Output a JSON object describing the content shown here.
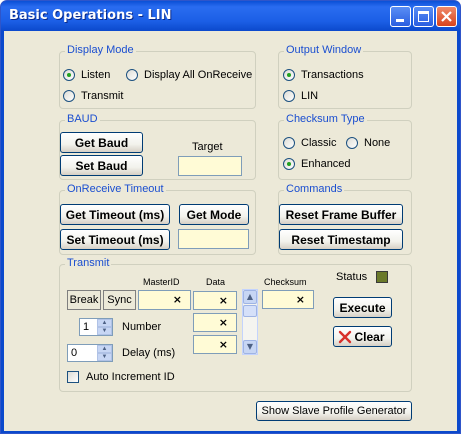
{
  "window": {
    "title": "Basic Operations - LIN"
  },
  "display_mode": {
    "legend": "Display Mode",
    "options": [
      {
        "label": "Listen",
        "selected": true
      },
      {
        "label": "Display All OnReceive",
        "selected": false
      },
      {
        "label": "Transmit",
        "selected": false
      }
    ]
  },
  "output_window": {
    "legend": "Output Window",
    "options": [
      {
        "label": "Transactions",
        "selected": true
      },
      {
        "label": "LIN",
        "selected": false
      }
    ]
  },
  "baud": {
    "legend": "BAUD",
    "get_label": "Get Baud",
    "set_label": "Set Baud",
    "target_label": "Target",
    "target_value": ""
  },
  "checksum_type": {
    "legend": "Checksum Type",
    "options": [
      {
        "label": "Classic",
        "selected": false
      },
      {
        "label": "None",
        "selected": false
      },
      {
        "label": "Enhanced",
        "selected": true
      }
    ]
  },
  "timeout": {
    "legend": "OnReceive Timeout",
    "get_label": "Get Timeout (ms)",
    "get_mode_label": "Get Mode",
    "set_label": "Set Timeout (ms)",
    "value": ""
  },
  "commands": {
    "legend": "Commands",
    "reset_frame_label": "Reset Frame Buffer",
    "reset_timestamp_label": "Reset Timestamp"
  },
  "transmit": {
    "legend": "Transmit",
    "masterid_header": "MasterID",
    "data_header": "Data",
    "checksum_header": "Checksum",
    "status_label": "Status",
    "status_color": "#6b7a2a",
    "break_label": "Break",
    "sync_label": "Sync",
    "clear_x": "×",
    "number_value": "1",
    "number_label": "Number",
    "delay_value": "0",
    "delay_label": "Delay (ms)",
    "auto_increment_label": "Auto Increment ID",
    "auto_increment_checked": false,
    "execute_label": "Execute",
    "clear_label": "Clear",
    "clear_icon_color": "#d8302a"
  },
  "footer": {
    "profile_label": "Show Slave Profile Generator"
  }
}
